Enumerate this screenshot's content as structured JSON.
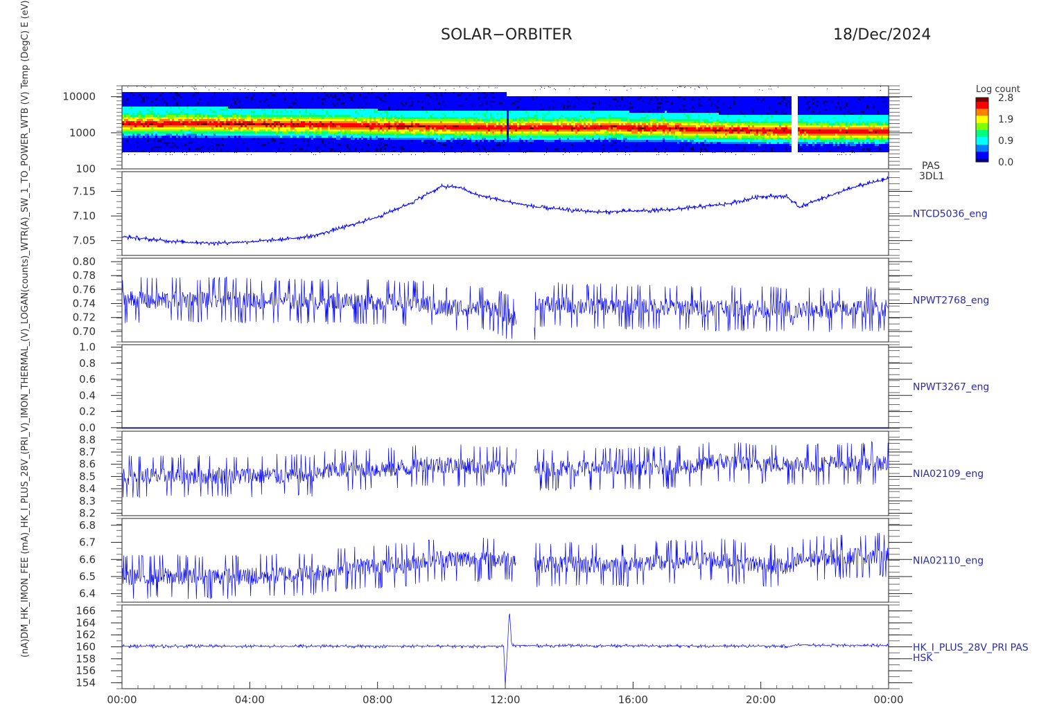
{
  "header": {
    "title": "SOLAR−ORBITER",
    "date": "18/Dec/2024"
  },
  "colorbar": {
    "label": "Log count",
    "ticks": [
      "2.8",
      "1.9",
      "0.9",
      "0.0"
    ],
    "range": [
      0.0,
      2.8
    ],
    "colors": [
      "#00007f",
      "#0000ff",
      "#007fff",
      "#00ffff",
      "#00ff7f",
      "#7fff00",
      "#ffff00",
      "#ff7f00",
      "#ff0000",
      "#7f0000"
    ]
  },
  "left_axis_label": "(nA)DM_HK_IMON_FEE (mA)_HK_I_PLUS_28V_(PRI_V)_IMON_THERMAL_(V)_LOGAN(counts)_WTR(A)_SW_1_TO_POWER_WTB (V)  Temp (DegC)  E (eV)",
  "x_axis": {
    "ticks": [
      "00:00",
      "04:00",
      "08:00",
      "12:00",
      "16:00",
      "20:00",
      "00:00"
    ],
    "range_hours": [
      0,
      24
    ]
  },
  "line_color": "#0000ff",
  "chart_data": [
    {
      "type": "heatmap",
      "panel_id": "pas",
      "right_label": "PAS",
      "right_label2": "3DL1",
      "ylabel": "E (eV)",
      "y_scale": "log",
      "ylim": [
        100,
        20000
      ],
      "yticks": [
        "10000",
        "1000",
        "100"
      ],
      "ytick_values": [
        10000,
        1000,
        100
      ],
      "peak_energy_ev": [
        [
          0,
          1900
        ],
        [
          2,
          1950
        ],
        [
          4,
          1850
        ],
        [
          6,
          1800
        ],
        [
          8,
          1650
        ],
        [
          10,
          1550
        ],
        [
          12,
          1450
        ],
        [
          13,
          1500
        ],
        [
          14,
          1450
        ],
        [
          15.5,
          1550
        ],
        [
          16,
          1400
        ],
        [
          17,
          1450
        ],
        [
          18,
          1300
        ],
        [
          19,
          1250
        ],
        [
          20,
          1200
        ],
        [
          21,
          1200
        ],
        [
          22,
          1150
        ],
        [
          23,
          1150
        ],
        [
          24,
          1150
        ]
      ],
      "data_gaps_hours": [
        [
          20.95,
          21.15
        ]
      ],
      "spike_hours": 12.05
    },
    {
      "type": "line",
      "panel_id": "ntcd5036",
      "right_label": "NTCD5036_eng",
      "ylabel": "Temp (DegC)",
      "ylim": [
        7.02,
        7.19
      ],
      "yticks": [
        "7.15",
        "7.10",
        "7.05"
      ],
      "ytick_values": [
        7.15,
        7.1,
        7.05
      ],
      "points": [
        [
          0,
          7.058
        ],
        [
          1,
          7.052
        ],
        [
          2,
          7.047
        ],
        [
          3,
          7.045
        ],
        [
          4,
          7.048
        ],
        [
          5,
          7.052
        ],
        [
          6,
          7.06
        ],
        [
          7,
          7.078
        ],
        [
          8,
          7.098
        ],
        [
          9,
          7.125
        ],
        [
          10,
          7.16
        ],
        [
          10.6,
          7.158
        ],
        [
          11,
          7.145
        ],
        [
          12,
          7.13
        ],
        [
          13,
          7.118
        ],
        [
          14,
          7.112
        ],
        [
          15,
          7.108
        ],
        [
          16,
          7.11
        ],
        [
          17,
          7.112
        ],
        [
          18,
          7.118
        ],
        [
          19,
          7.125
        ],
        [
          20,
          7.14
        ],
        [
          20.8,
          7.14
        ],
        [
          21.2,
          7.118
        ],
        [
          22,
          7.138
        ],
        [
          23,
          7.16
        ],
        [
          24,
          7.176
        ]
      ],
      "noise": 0.004
    },
    {
      "type": "line",
      "panel_id": "npwt2768",
      "right_label": "NPWT2768_eng",
      "ylabel": "(V)",
      "ylim": [
        0.685,
        0.805
      ],
      "yticks": [
        "0.80",
        "0.78",
        "0.76",
        "0.74",
        "0.72",
        "0.70"
      ],
      "ytick_values": [
        0.8,
        0.78,
        0.76,
        0.74,
        0.72,
        0.7
      ],
      "points": [
        [
          0,
          0.745
        ],
        [
          4,
          0.745
        ],
        [
          8,
          0.742
        ],
        [
          9.5,
          0.74
        ],
        [
          10,
          0.733
        ],
        [
          11.5,
          0.735
        ],
        [
          12,
          0.722
        ],
        [
          12.3,
          0.718
        ],
        [
          12.9,
          0.715
        ],
        [
          13,
          0.738
        ],
        [
          16,
          0.735
        ],
        [
          20.9,
          0.732
        ],
        [
          21.0,
          0.705
        ],
        [
          21.1,
          0.73
        ],
        [
          24,
          0.733
        ]
      ],
      "noise": 0.03,
      "gaps_hours": [
        [
          12.35,
          12.9
        ]
      ]
    },
    {
      "type": "line",
      "panel_id": "npwt3267",
      "right_label": "NPWT3267_eng",
      "ylabel": "(A)",
      "ylim": [
        -0.01,
        1.03
      ],
      "yticks": [
        "1.0",
        "0.8",
        "0.6",
        "0.4",
        "0.2",
        "0.0"
      ],
      "ytick_values": [
        1.0,
        0.8,
        0.6,
        0.4,
        0.2,
        0.0
      ],
      "points": [
        [
          0,
          0.0
        ],
        [
          24,
          0.0
        ]
      ],
      "noise": 0
    },
    {
      "type": "line",
      "panel_id": "nia02109",
      "right_label": "NIA02109_eng",
      "ylabel": "(V)",
      "ylim": [
        8.18,
        8.87
      ],
      "yticks": [
        "8.8",
        "8.7",
        "8.6",
        "8.5",
        "8.4",
        "8.3",
        "8.2"
      ],
      "ytick_values": [
        8.8,
        8.7,
        8.6,
        8.5,
        8.4,
        8.3,
        8.2
      ],
      "points": [
        [
          0,
          8.5
        ],
        [
          6,
          8.51
        ],
        [
          6.5,
          8.55
        ],
        [
          9,
          8.57
        ],
        [
          9.5,
          8.6
        ],
        [
          12.3,
          8.57
        ],
        [
          12.9,
          8.56
        ],
        [
          16,
          8.57
        ],
        [
          18,
          8.58
        ],
        [
          18.5,
          8.62
        ],
        [
          21,
          8.6
        ],
        [
          24,
          8.61
        ]
      ],
      "noise": 0.16,
      "gaps_hours": [
        [
          12.35,
          12.9
        ]
      ]
    },
    {
      "type": "line",
      "panel_id": "nia02110",
      "right_label": "NIA02110_eng",
      "ylabel": "(V)",
      "ylim": [
        6.35,
        6.84
      ],
      "yticks": [
        "6.8",
        "6.7",
        "6.6",
        "6.5",
        "6.4"
      ],
      "ytick_values": [
        6.8,
        6.7,
        6.6,
        6.5,
        6.4
      ],
      "points": [
        [
          0,
          6.5
        ],
        [
          4,
          6.5
        ],
        [
          6,
          6.52
        ],
        [
          7,
          6.55
        ],
        [
          9,
          6.57
        ],
        [
          9.5,
          6.6
        ],
        [
          12.3,
          6.6
        ],
        [
          12.9,
          6.57
        ],
        [
          16,
          6.57
        ],
        [
          18.5,
          6.6
        ],
        [
          21,
          6.55
        ],
        [
          21.2,
          6.6
        ],
        [
          24,
          6.63
        ]
      ],
      "noise": 0.12,
      "gaps_hours": [
        [
          12.35,
          12.9
        ]
      ]
    },
    {
      "type": "line",
      "panel_id": "hk28v",
      "right_label": "HK_I_PLUS_28V_PRI PAS",
      "right_label2": "HSK",
      "ylabel": "(mA)",
      "ylim": [
        153,
        167
      ],
      "yticks": [
        "166",
        "164",
        "162",
        "160",
        "158",
        "156",
        "154"
      ],
      "ytick_values": [
        166,
        164,
        162,
        160,
        158,
        156,
        154
      ],
      "points": [
        [
          0,
          160.1
        ],
        [
          11.95,
          160.1
        ],
        [
          12.0,
          153.5
        ],
        [
          12.07,
          160
        ],
        [
          12.13,
          166.2
        ],
        [
          12.2,
          160.2
        ],
        [
          21.0,
          160.1
        ],
        [
          21.05,
          160.3
        ],
        [
          24,
          160.2
        ]
      ],
      "noise": 0.25
    }
  ]
}
